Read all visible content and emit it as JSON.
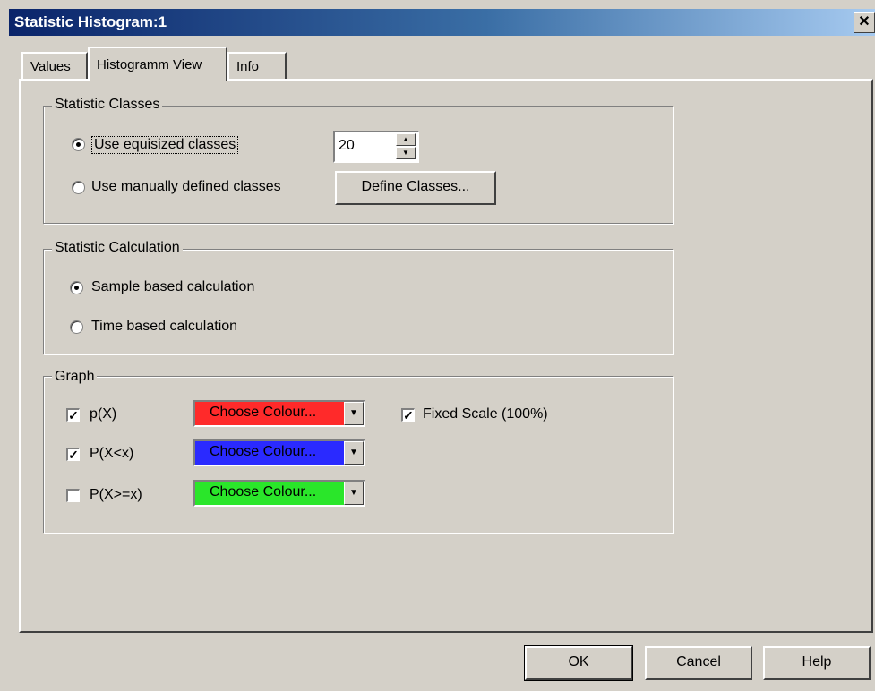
{
  "window": {
    "title": "Statistic Histogram:1",
    "close_glyph": "X"
  },
  "tabs": [
    {
      "label": "Values",
      "active": false
    },
    {
      "label": "Histogramm View",
      "active": true
    },
    {
      "label": "Info",
      "active": false
    }
  ],
  "statistic_classes": {
    "title": "Statistic Classes",
    "equisized_label": "Use equisized classes",
    "equisized_selected": true,
    "class_count": "20",
    "manual_label": "Use manually defined classes",
    "manual_selected": false,
    "define_button": "Define Classes..."
  },
  "statistic_calculation": {
    "title": "Statistic Calculation",
    "sample_label": "Sample based calculation",
    "sample_selected": true,
    "time_label": "Time based calculation",
    "time_selected": false
  },
  "graph": {
    "title": "Graph",
    "rows": [
      {
        "label": "p(X)",
        "checked": true,
        "colour_label": "Choose Colour...",
        "colour": "#ff2a2a"
      },
      {
        "label": "P(X<x)",
        "checked": true,
        "colour_label": "Choose Colour...",
        "colour": "#2a2aff"
      },
      {
        "label": "P(X>=x)",
        "checked": false,
        "colour_label": "Choose Colour...",
        "colour": "#2ae62a"
      }
    ],
    "fixed_scale_label": "Fixed Scale (100%)",
    "fixed_scale_checked": true
  },
  "buttons": {
    "ok": "OK",
    "cancel": "Cancel",
    "help": "Help"
  },
  "icons": {
    "close": "close-icon",
    "spin_up": "spin-up-icon",
    "spin_down": "spin-down-icon",
    "dropdown": "chevron-down-icon"
  }
}
